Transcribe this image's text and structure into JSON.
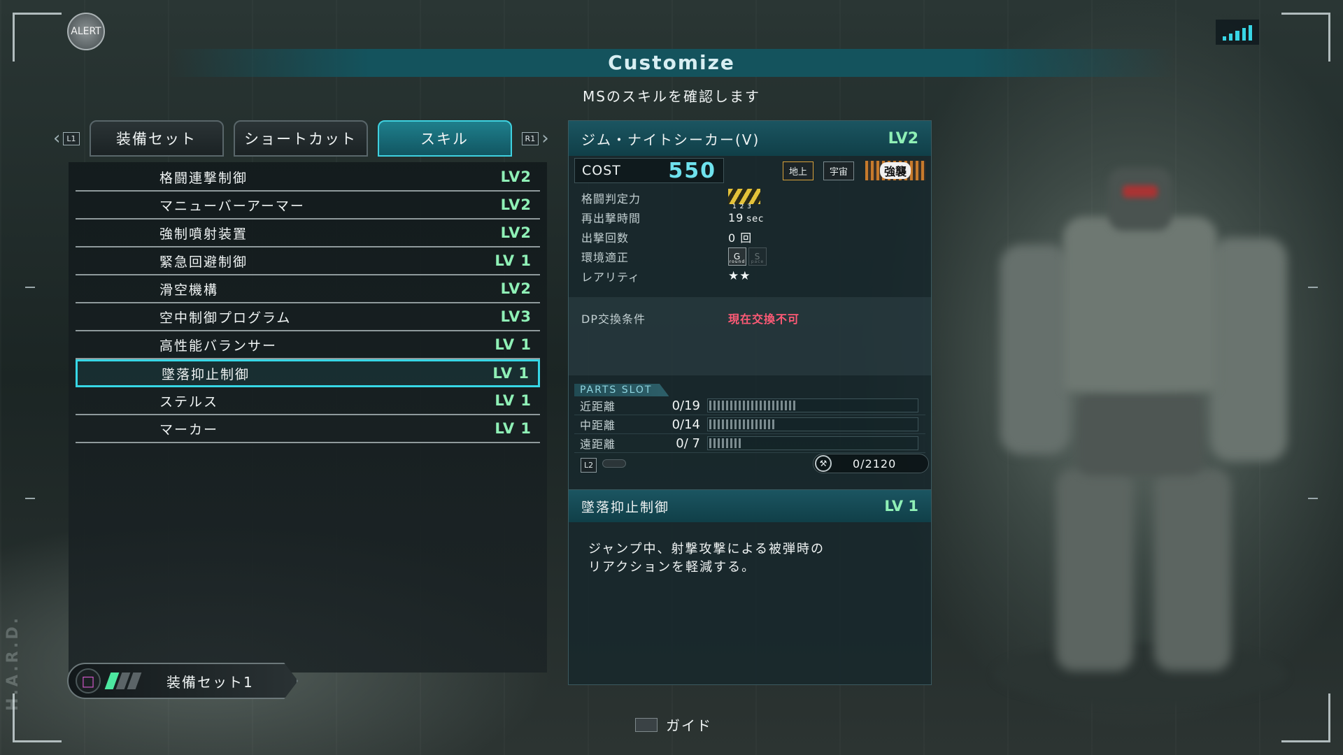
{
  "header": {
    "alert_label": "ALERT",
    "title": "Customize",
    "subtitle": "MSのスキルを確認します"
  },
  "tabs": {
    "left_shoulder": "L1",
    "right_shoulder": "R1",
    "items": [
      {
        "label": "装備セット",
        "active": false
      },
      {
        "label": "ショートカット",
        "active": false
      },
      {
        "label": "スキル",
        "active": true
      }
    ]
  },
  "skills": [
    {
      "name": "格闘連撃制御",
      "level": "LV2"
    },
    {
      "name": "マニューバーアーマー",
      "level": "LV2"
    },
    {
      "name": "強制噴射装置",
      "level": "LV2"
    },
    {
      "name": "緊急回避制御",
      "level": "LV 1"
    },
    {
      "name": "滑空機構",
      "level": "LV2"
    },
    {
      "name": "空中制御プログラム",
      "level": "LV3"
    },
    {
      "name": "高性能バランサー",
      "level": "LV 1"
    },
    {
      "name": "墜落抑止制御",
      "level": "LV 1",
      "selected": true
    },
    {
      "name": "ステルス",
      "level": "LV 1"
    },
    {
      "name": "マーカー",
      "level": "LV 1"
    }
  ],
  "equip_set": {
    "label": "装備セット1",
    "button_icon": "square-button-icon",
    "bars_total": 3,
    "bars_active": 1
  },
  "ms": {
    "name": "ジム・ナイトシーカー(V)",
    "level": "LV2",
    "cost_label": "COST",
    "cost": "550",
    "env_ground": "地上",
    "env_space": "宇宙",
    "type": "強襲",
    "stats": {
      "melee_label": "格闘判定力",
      "melee_scale": "1 2 3",
      "respawn_label": "再出撃時間",
      "respawn_value": "19",
      "respawn_unit": "sec",
      "sorties_label": "出撃回数",
      "sorties_value": "0 回",
      "env_label": "環境適正",
      "env_ground_short": "G",
      "env_ground_sub": "round",
      "env_space_short": "S",
      "env_space_sub": "pace",
      "rarity_label": "レアリティ",
      "rarity": "★★"
    },
    "dp_label": "DP交換条件",
    "dp_value": "現在交換不可"
  },
  "parts": {
    "title": "PARTS SLOT",
    "rows": [
      {
        "label": "近距離",
        "value": "0/19",
        "fill": 19
      },
      {
        "label": "中距離",
        "value": "0/14",
        "fill": 14
      },
      {
        "label": "遠距離",
        "value": "0/ 7",
        "fill": 7
      }
    ],
    "l2_key": "L2",
    "capacity": "0/2120"
  },
  "skill_detail": {
    "name": "墜落抑止制御",
    "level": "LV 1",
    "description": "ジャンプ中、射撃攻撃による被弾時の\nリアクションを軽減する。"
  },
  "footer": {
    "guide_label": "ガイド",
    "side_text": "H.A.R.D."
  },
  "colors": {
    "accent": "#37d7e6",
    "level_text": "#8ff0b6",
    "cost": "#6fe2ee",
    "warning": "#ff5a76"
  }
}
